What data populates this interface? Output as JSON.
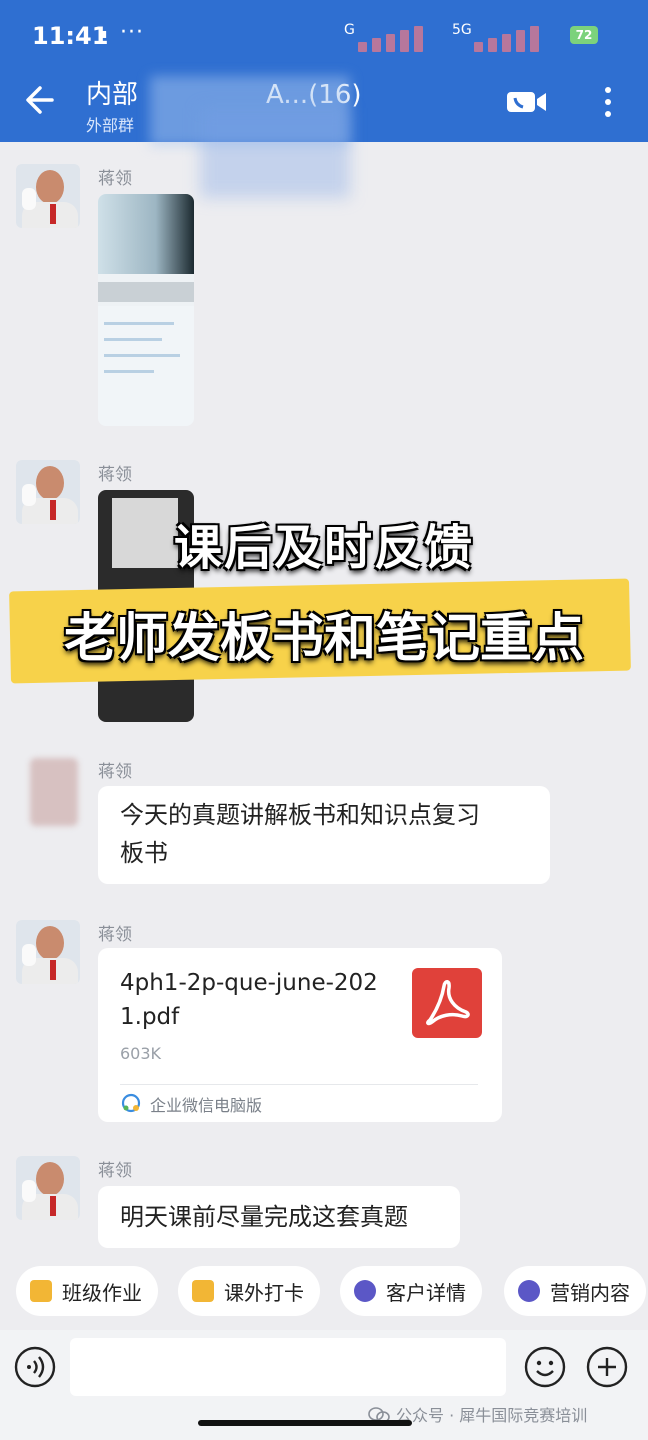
{
  "status_bar": {
    "time": "11:41",
    "dot": "▪",
    "more": "···",
    "network_1": "G",
    "network_2": "5G",
    "battery": "72"
  },
  "header": {
    "back_icon": "arrow-left-icon",
    "title_prefix": "内部",
    "title_suffix": "A...(16)",
    "subtitle": "外部群",
    "call_icon": "video-call-icon",
    "more_icon": "more-vertical-icon",
    "colors": {
      "header_bg": "#2f6fd1",
      "page_bg": "#ededf0"
    }
  },
  "messages": [
    {
      "sender": "蒋领",
      "type": "image"
    },
    {
      "sender": "蒋领",
      "type": "image"
    },
    {
      "sender": "蒋领",
      "type": "text",
      "lines": [
        "今天的真题讲解板书和知识点复习",
        "板书"
      ]
    },
    {
      "sender": "蒋领",
      "type": "file",
      "file_name": "4ph1-2p-que-june-2021.pdf",
      "file_size": "603K",
      "source": "企业微信电脑版",
      "file_icon": "pdf-icon"
    },
    {
      "sender": "蒋领",
      "type": "text",
      "lines": [
        "明天课前尽量完成这套真题"
      ]
    }
  ],
  "overlay": {
    "line1": "课后及时反馈",
    "line2": "老师发板书和笔记重点",
    "band_color": "#f7d24a"
  },
  "quick_actions": [
    {
      "label": "班级作业",
      "icon": "homework-icon"
    },
    {
      "label": "课外打卡",
      "icon": "checkin-icon"
    },
    {
      "label": "客户详情",
      "icon": "customer-icon"
    },
    {
      "label": "营销内容",
      "icon": "marketing-icon"
    }
  ],
  "input_bar": {
    "placeholder": "",
    "voice_icon": "voice-icon",
    "emoji_icon": "emoji-icon",
    "plus_icon": "plus-icon"
  },
  "watermark": "公众号 · 犀牛国际竞赛培训"
}
